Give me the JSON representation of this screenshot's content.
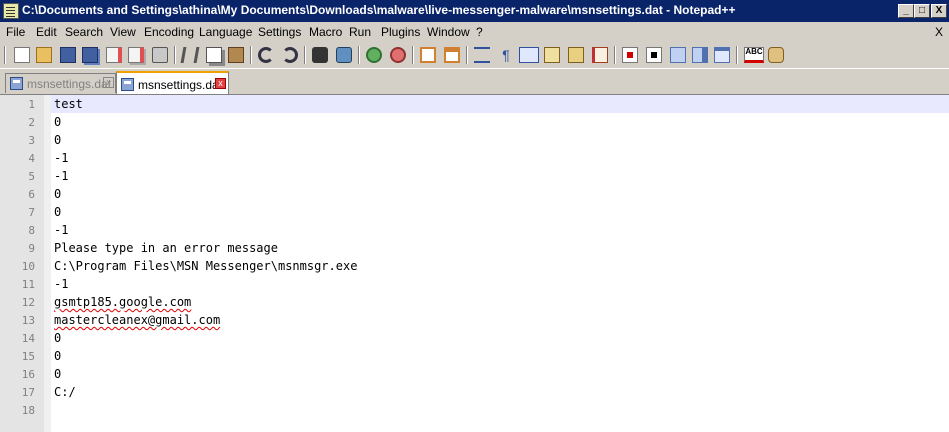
{
  "window": {
    "title": "C:\\Documents and Settings\\athina\\My Documents\\Downloads\\malware\\live-messenger-malware\\msnsettings.dat - Notepad++",
    "minimize": "_",
    "restore": "□",
    "close": "X",
    "colors": {
      "titlebar": "#0a246a",
      "chrome": "#d4d0c8"
    }
  },
  "menu": {
    "items": [
      "File",
      "Edit",
      "Search",
      "View",
      "Encoding",
      "Language",
      "Settings",
      "Macro",
      "Run",
      "Plugins",
      "Window",
      "?"
    ],
    "doc_close": "X"
  },
  "toolbar": {
    "icons": [
      "new-file-icon",
      "open-file-icon",
      "save-icon",
      "save-all-icon",
      "close-icon",
      "close-all-icon",
      "print-icon",
      "cut-icon",
      "copy-icon",
      "paste-icon",
      "undo-icon",
      "redo-icon",
      "find-icon",
      "replace-icon",
      "zoom-in-icon",
      "zoom-out-icon",
      "sync-vertical-icon",
      "sync-horizontal-icon",
      "word-wrap-icon",
      "show-all-chars-icon",
      "indent-guide-icon",
      "user-define-icon",
      "doc-map-icon",
      "function-list-icon",
      "macro-record-icon",
      "macro-stop-icon",
      "macro-play-icon",
      "macro-run-multiple-icon",
      "macro-save-icon",
      "spell-check-icon",
      "plugin-icon"
    ]
  },
  "tabs": [
    {
      "label": "msnsettings.dat",
      "active": false,
      "close": "x"
    },
    {
      "label": "msnsettings.dat",
      "active": true,
      "close": "x"
    }
  ],
  "editor": {
    "lines": [
      {
        "num": "1",
        "text": "test"
      },
      {
        "num": "2",
        "text": "0"
      },
      {
        "num": "3",
        "text": "0"
      },
      {
        "num": "4",
        "text": "-1"
      },
      {
        "num": "5",
        "text": "-1"
      },
      {
        "num": "6",
        "text": "0"
      },
      {
        "num": "7",
        "text": "0"
      },
      {
        "num": "8",
        "text": "-1"
      },
      {
        "num": "9",
        "text": "Please type in an error message"
      },
      {
        "num": "10",
        "text": "C:\\Program Files\\MSN Messenger\\msnmsgr.exe"
      },
      {
        "num": "11",
        "text": "-1"
      },
      {
        "num": "12",
        "text": "gsmtp185.google.com"
      },
      {
        "num": "13",
        "text": "mastercleanex@gmail.com"
      },
      {
        "num": "14",
        "text": "0"
      },
      {
        "num": "15",
        "text": "0"
      },
      {
        "num": "16",
        "text": "0"
      },
      {
        "num": "17",
        "text": "C:/"
      },
      {
        "num": "18",
        "text": ""
      }
    ]
  }
}
